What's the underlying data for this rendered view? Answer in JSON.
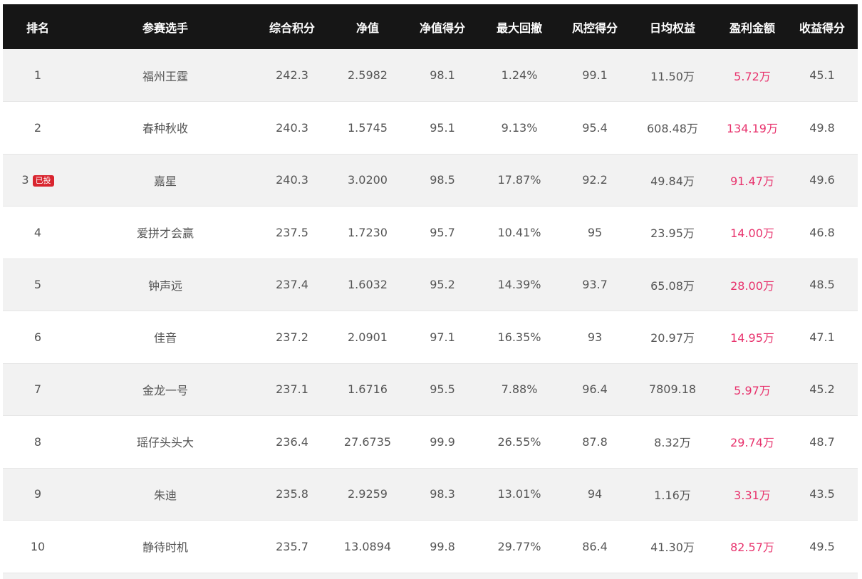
{
  "table": {
    "headers": [
      "排名",
      "参赛选手",
      "综合积分",
      "净值",
      "净值得分",
      "最大回撤",
      "风控得分",
      "日均权益",
      "盈利金额",
      "收益得分"
    ],
    "rows": [
      {
        "rank": "1",
        "badge": "",
        "name": "福州王霆",
        "score": "242.3",
        "nav": "2.5982",
        "nav_score": "98.1",
        "drawdown": "1.24%",
        "risk_score": "99.1",
        "avg_equity": "11.50万",
        "profit": "5.72万",
        "return_score": "45.1"
      },
      {
        "rank": "2",
        "badge": "",
        "name": "春种秋收",
        "score": "240.3",
        "nav": "1.5745",
        "nav_score": "95.1",
        "drawdown": "9.13%",
        "risk_score": "95.4",
        "avg_equity": "608.48万",
        "profit": "134.19万",
        "return_score": "49.8"
      },
      {
        "rank": "3",
        "badge": "已投",
        "name": "嘉星",
        "score": "240.3",
        "nav": "3.0200",
        "nav_score": "98.5",
        "drawdown": "17.87%",
        "risk_score": "92.2",
        "avg_equity": "49.84万",
        "profit": "91.47万",
        "return_score": "49.6"
      },
      {
        "rank": "4",
        "badge": "",
        "name": "爱拼才会赢",
        "score": "237.5",
        "nav": "1.7230",
        "nav_score": "95.7",
        "drawdown": "10.41%",
        "risk_score": "95",
        "avg_equity": "23.95万",
        "profit": "14.00万",
        "return_score": "46.8"
      },
      {
        "rank": "5",
        "badge": "",
        "name": "钟声远",
        "score": "237.4",
        "nav": "1.6032",
        "nav_score": "95.2",
        "drawdown": "14.39%",
        "risk_score": "93.7",
        "avg_equity": "65.08万",
        "profit": "28.00万",
        "return_score": "48.5"
      },
      {
        "rank": "6",
        "badge": "",
        "name": "佳音",
        "score": "237.2",
        "nav": "2.0901",
        "nav_score": "97.1",
        "drawdown": "16.35%",
        "risk_score": "93",
        "avg_equity": "20.97万",
        "profit": "14.95万",
        "return_score": "47.1"
      },
      {
        "rank": "7",
        "badge": "",
        "name": "金龙一号",
        "score": "237.1",
        "nav": "1.6716",
        "nav_score": "95.5",
        "drawdown": "7.88%",
        "risk_score": "96.4",
        "avg_equity": "7809.18",
        "profit": "5.97万",
        "return_score": "45.2"
      },
      {
        "rank": "8",
        "badge": "",
        "name": "瑶仔头头大",
        "score": "236.4",
        "nav": "27.6735",
        "nav_score": "99.9",
        "drawdown": "26.55%",
        "risk_score": "87.8",
        "avg_equity": "8.32万",
        "profit": "29.74万",
        "return_score": "48.7"
      },
      {
        "rank": "9",
        "badge": "",
        "name": "朱迪",
        "score": "235.8",
        "nav": "2.9259",
        "nav_score": "98.3",
        "drawdown": "13.01%",
        "risk_score": "94",
        "avg_equity": "1.16万",
        "profit": "3.31万",
        "return_score": "43.5"
      },
      {
        "rank": "10",
        "badge": "",
        "name": "静待时机",
        "score": "235.7",
        "nav": "13.0894",
        "nav_score": "99.8",
        "drawdown": "29.77%",
        "risk_score": "86.4",
        "avg_equity": "41.30万",
        "profit": "82.57万",
        "return_score": "49.5"
      }
    ]
  },
  "colors": {
    "header_bg": "#161616",
    "row_alt_bg": "#f2f2f2",
    "profit_text": "#e8336d",
    "badge_bg": "#d9252f"
  }
}
